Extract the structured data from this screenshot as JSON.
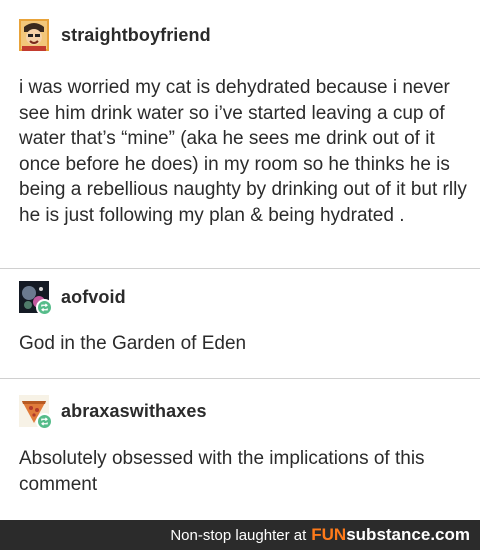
{
  "posts": [
    {
      "username": "straightboyfriend",
      "text": "i was worried my cat is dehydrated because i never see him drink water so i’ve started leaving a cup of water that’s “mine” (aka he sees me drink out of it once before he does) in my room so he thinks he is being a rebellious naughty by drinking out of it but rlly he is just following my plan & being hydrated ."
    },
    {
      "username": "aofvoid",
      "text": "God in the Garden of Eden"
    },
    {
      "username": "abraxaswithaxes",
      "text": "Absolutely obsessed with the implications of this comment"
    }
  ],
  "footer": {
    "tagline": "Non-stop laughter at",
    "brand_fun": "FUN",
    "brand_rest": "substance",
    "brand_tld": ".com"
  },
  "colors": {
    "reblog_badge": "#56bc8a",
    "footer_bg": "#2b2b2b",
    "brand_accent": "#ff7a1a"
  },
  "icons": [
    "avatar-cartoon-icon",
    "avatar-space-icon",
    "avatar-pizza-icon",
    "reblog-icon"
  ]
}
